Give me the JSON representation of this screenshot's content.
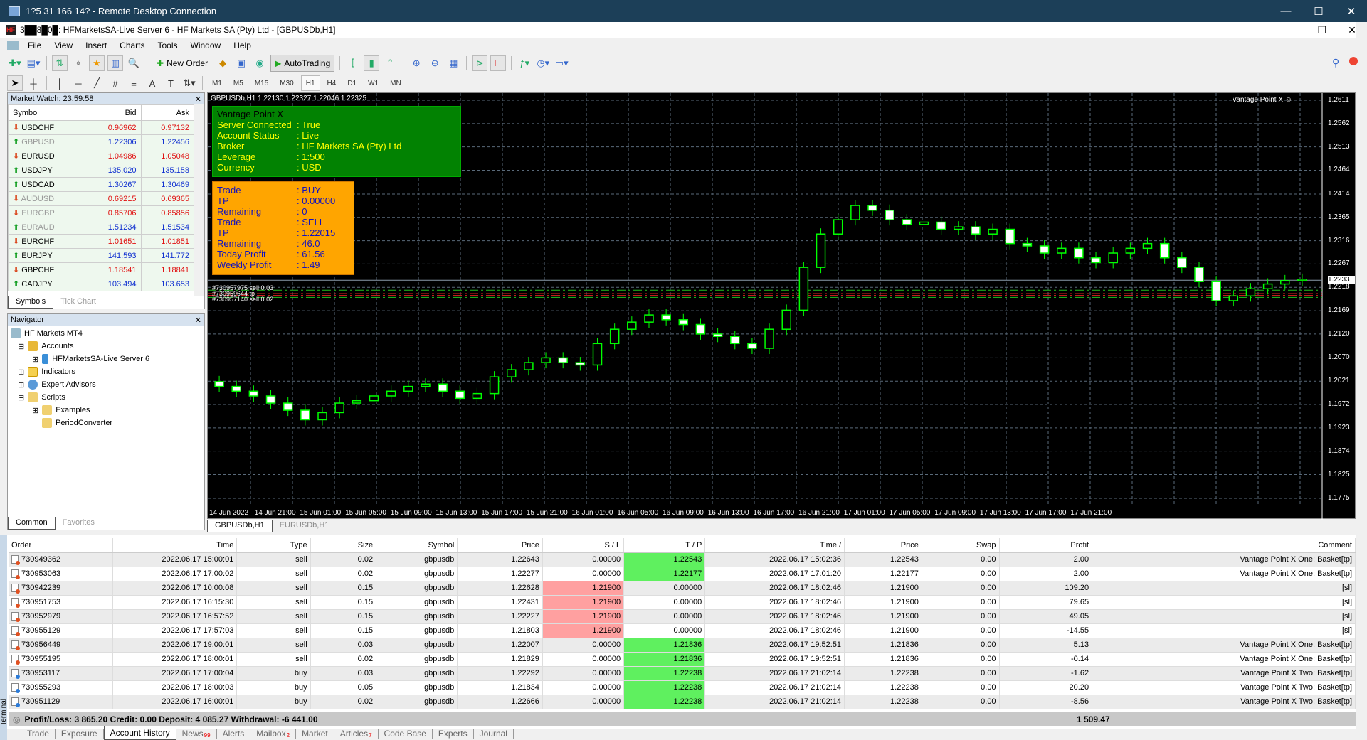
{
  "rdp": {
    "title": "1?5 31 166 14? - Remote Desktop Connection",
    "minimize": "—",
    "maximize": "☐",
    "close": "✕"
  },
  "app": {
    "title": "3██8█0█: HFMarketsSA-Live Server 6 - HF Markets SA (Pty) Ltd - [GBPUSDb,H1]",
    "logo": "HF"
  },
  "menu": [
    "File",
    "View",
    "Insert",
    "Charts",
    "Tools",
    "Window",
    "Help"
  ],
  "toolbar": {
    "new_order": "New Order",
    "autotrading": "AutoTrading"
  },
  "timeframes": [
    "M1",
    "M5",
    "M15",
    "M30",
    "H1",
    "H4",
    "D1",
    "W1",
    "MN"
  ],
  "active_timeframe": "H1",
  "market_watch": {
    "title": "Market Watch: 23:59:58",
    "columns": [
      "Symbol",
      "Bid",
      "Ask"
    ],
    "rows": [
      {
        "symbol": "USDCHF",
        "dir": "down",
        "bid": "0.96962",
        "ask": "0.97132",
        "dim": false
      },
      {
        "symbol": "GBPUSD",
        "dir": "up",
        "bid": "1.22306",
        "ask": "1.22456",
        "dim": true
      },
      {
        "symbol": "EURUSD",
        "dir": "down",
        "bid": "1.04986",
        "ask": "1.05048",
        "dim": false
      },
      {
        "symbol": "USDJPY",
        "dir": "up",
        "bid": "135.020",
        "ask": "135.158",
        "dim": false
      },
      {
        "symbol": "USDCAD",
        "dir": "up",
        "bid": "1.30267",
        "ask": "1.30469",
        "dim": false
      },
      {
        "symbol": "AUDUSD",
        "dir": "down",
        "bid": "0.69215",
        "ask": "0.69365",
        "dim": true
      },
      {
        "symbol": "EURGBP",
        "dir": "down",
        "bid": "0.85706",
        "ask": "0.85856",
        "dim": true
      },
      {
        "symbol": "EURAUD",
        "dir": "up",
        "bid": "1.51234",
        "ask": "1.51534",
        "dim": true
      },
      {
        "symbol": "EURCHF",
        "dir": "down",
        "bid": "1.01651",
        "ask": "1.01851",
        "dim": false
      },
      {
        "symbol": "EURJPY",
        "dir": "up",
        "bid": "141.593",
        "ask": "141.772",
        "dim": false
      },
      {
        "symbol": "GBPCHF",
        "dir": "down",
        "bid": "1.18541",
        "ask": "1.18841",
        "dim": false
      },
      {
        "symbol": "CADJPY",
        "dir": "up",
        "bid": "103.494",
        "ask": "103.653",
        "dim": false
      }
    ],
    "tabs": [
      "Symbols",
      "Tick Chart"
    ]
  },
  "navigator": {
    "title": "Navigator",
    "items": [
      "HF Markets MT4",
      "Accounts",
      "HFMarketsSA-Live Server 6",
      "Indicators",
      "Expert Advisors",
      "Scripts",
      "Examples",
      "PeriodConverter"
    ],
    "tabs": [
      "Common",
      "Favorites"
    ]
  },
  "chart": {
    "title": "GBPUSDb,H1  1.22130 1.22327 1.22046 1.22325",
    "ea_label": "Vantage Point X ☺",
    "info_panel": {
      "heading": "Vantage Point X",
      "rows": [
        {
          "k": "Server Connected",
          "v": "True"
        },
        {
          "k": "Account Status",
          "v": "Live"
        },
        {
          "k": "Broker",
          "v": "HF Markets SA (Pty) Ltd"
        },
        {
          "k": "Leverage",
          "v": "1:500"
        },
        {
          "k": "Currency",
          "v": "USD"
        }
      ]
    },
    "trade_panel": [
      {
        "k": "Trade",
        "v": "BUY"
      },
      {
        "k": "TP",
        "v": "0.00000"
      },
      {
        "k": "Remaining",
        "v": "0"
      },
      {
        "k": "Trade",
        "v": "SELL"
      },
      {
        "k": "TP",
        "v": "1.22015"
      },
      {
        "k": "Remaining",
        "v": "46.0"
      },
      {
        "k": "Today Profit",
        "v": "61.56"
      },
      {
        "k": "Weekly Profit",
        "v": "1.49"
      }
    ],
    "order_labels": [
      "#730957975 sell 0.03",
      "#730959644 tp",
      "#730957140 sell 0.02"
    ],
    "price_axis": [
      "1.2611",
      "1.2562",
      "1.2513",
      "1.2464",
      "1.2414",
      "1.2365",
      "1.2316",
      "1.2267",
      "1.2218",
      "1.2169",
      "1.2120",
      "1.2070",
      "1.2021",
      "1.1972",
      "1.1923",
      "1.1874",
      "1.1825",
      "1.1775"
    ],
    "current_price": "1.2233",
    "time_axis": [
      "14 Jun 2022",
      "14 Jun 21:00",
      "15 Jun 01:00",
      "15 Jun 05:00",
      "15 Jun 09:00",
      "15 Jun 13:00",
      "15 Jun 17:00",
      "15 Jun 21:00",
      "16 Jun 01:00",
      "16 Jun 05:00",
      "16 Jun 09:00",
      "16 Jun 13:00",
      "16 Jun 17:00",
      "16 Jun 21:00",
      "17 Jun 01:00",
      "17 Jun 05:00",
      "17 Jun 09:00",
      "17 Jun 13:00",
      "17 Jun 17:00",
      "17 Jun 21:00"
    ],
    "candles_close_approx": [
      1.201,
      1.2,
      1.199,
      1.1975,
      1.196,
      1.194,
      1.1955,
      1.1975,
      1.198,
      1.199,
      1.2,
      1.201,
      1.2015,
      1.2,
      1.1985,
      1.1995,
      1.203,
      1.2045,
      1.206,
      1.207,
      1.206,
      1.2055,
      1.21,
      1.213,
      1.2145,
      1.216,
      1.215,
      1.214,
      1.212,
      1.2115,
      1.21,
      1.209,
      1.213,
      1.217,
      1.226,
      1.233,
      1.236,
      1.239,
      1.238,
      1.236,
      1.235,
      1.2355,
      1.234,
      1.2345,
      1.233,
      1.234,
      1.231,
      1.2305,
      1.229,
      1.23,
      1.228,
      1.227,
      1.229,
      1.23,
      1.231,
      1.228,
      1.226,
      1.223,
      1.219,
      1.22,
      1.2215,
      1.2225,
      1.2232,
      1.2235
    ],
    "tabs": [
      "GBPUSDb,H1",
      "EURUSDb,H1"
    ]
  },
  "history": {
    "columns": [
      "Order",
      "Time",
      "Type",
      "Size",
      "Symbol",
      "Price",
      "S / L",
      "T / P",
      "Time  /",
      "Price",
      "Swap",
      "Profit",
      "Comment"
    ],
    "rows": [
      [
        "730949362",
        "2022.06.17 15:00:01",
        "sell",
        "0.02",
        "gbpusdb",
        "1.22643",
        "0.00000",
        "1.22543",
        "2022.06.17 15:02:36",
        "1.22543",
        "0.00",
        "2.00",
        "Vantage Point X One: Basket[tp]"
      ],
      [
        "730953063",
        "2022.06.17 17:00:02",
        "sell",
        "0.02",
        "gbpusdb",
        "1.22277",
        "0.00000",
        "1.22177",
        "2022.06.17 17:01:20",
        "1.22177",
        "0.00",
        "2.00",
        "Vantage Point X One: Basket[tp]"
      ],
      [
        "730942239",
        "2022.06.17 10:00:08",
        "sell",
        "0.15",
        "gbpusdb",
        "1.22628",
        "1.21900",
        "0.00000",
        "2022.06.17 18:02:46",
        "1.21900",
        "0.00",
        "109.20",
        "[sl]"
      ],
      [
        "730951753",
        "2022.06.17 16:15:30",
        "sell",
        "0.15",
        "gbpusdb",
        "1.22431",
        "1.21900",
        "0.00000",
        "2022.06.17 18:02:46",
        "1.21900",
        "0.00",
        "79.65",
        "[sl]"
      ],
      [
        "730952979",
        "2022.06.17 16:57:52",
        "sell",
        "0.15",
        "gbpusdb",
        "1.22227",
        "1.21900",
        "0.00000",
        "2022.06.17 18:02:46",
        "1.21900",
        "0.00",
        "49.05",
        "[sl]"
      ],
      [
        "730955129",
        "2022.06.17 17:57:03",
        "sell",
        "0.15",
        "gbpusdb",
        "1.21803",
        "1.21900",
        "0.00000",
        "2022.06.17 18:02:46",
        "1.21900",
        "0.00",
        "-14.55",
        "[sl]"
      ],
      [
        "730956449",
        "2022.06.17 19:00:01",
        "sell",
        "0.03",
        "gbpusdb",
        "1.22007",
        "0.00000",
        "1.21836",
        "2022.06.17 19:52:51",
        "1.21836",
        "0.00",
        "5.13",
        "Vantage Point X One: Basket[tp]"
      ],
      [
        "730955195",
        "2022.06.17 18:00:01",
        "sell",
        "0.02",
        "gbpusdb",
        "1.21829",
        "0.00000",
        "1.21836",
        "2022.06.17 19:52:51",
        "1.21836",
        "0.00",
        "-0.14",
        "Vantage Point X One: Basket[tp]"
      ],
      [
        "730953117",
        "2022.06.17 17:00:04",
        "buy",
        "0.03",
        "gbpusdb",
        "1.22292",
        "0.00000",
        "1.22238",
        "2022.06.17 21:02:14",
        "1.22238",
        "0.00",
        "-1.62",
        "Vantage Point X Two: Basket[tp]"
      ],
      [
        "730955293",
        "2022.06.17 18:00:03",
        "buy",
        "0.05",
        "gbpusdb",
        "1.21834",
        "0.00000",
        "1.22238",
        "2022.06.17 21:02:14",
        "1.22238",
        "0.00",
        "20.20",
        "Vantage Point X Two: Basket[tp]"
      ],
      [
        "730951129",
        "2022.06.17 16:00:01",
        "buy",
        "0.02",
        "gbpusdb",
        "1.22666",
        "0.00000",
        "1.22238",
        "2022.06.17 21:02:14",
        "1.22238",
        "0.00",
        "-8.56",
        "Vantage Point X Two: Basket[tp]"
      ]
    ],
    "summary": "Profit/Loss: 3 865.20  Credit: 0.00  Deposit: 4 085.27  Withdrawal: -6 441.00",
    "total_profit": "1 509.47"
  },
  "terminal": {
    "side_label": "Terminal",
    "tabs": [
      {
        "label": "Trade"
      },
      {
        "label": "Exposure"
      },
      {
        "label": "Account History",
        "active": true
      },
      {
        "label": "News",
        "badge": "99"
      },
      {
        "label": "Alerts"
      },
      {
        "label": "Mailbox",
        "badge": "2"
      },
      {
        "label": "Market"
      },
      {
        "label": "Articles",
        "badge": "7"
      },
      {
        "label": "Code Base"
      },
      {
        "label": "Experts"
      },
      {
        "label": "Journal"
      }
    ]
  },
  "colors": {
    "sl_bg": "#ffa0a0",
    "tp_bg": "#5ff05f",
    "candle": "#00ff00",
    "chart_bg": "#000000",
    "info_green": "#028202",
    "info_orange": "#ffa500"
  }
}
